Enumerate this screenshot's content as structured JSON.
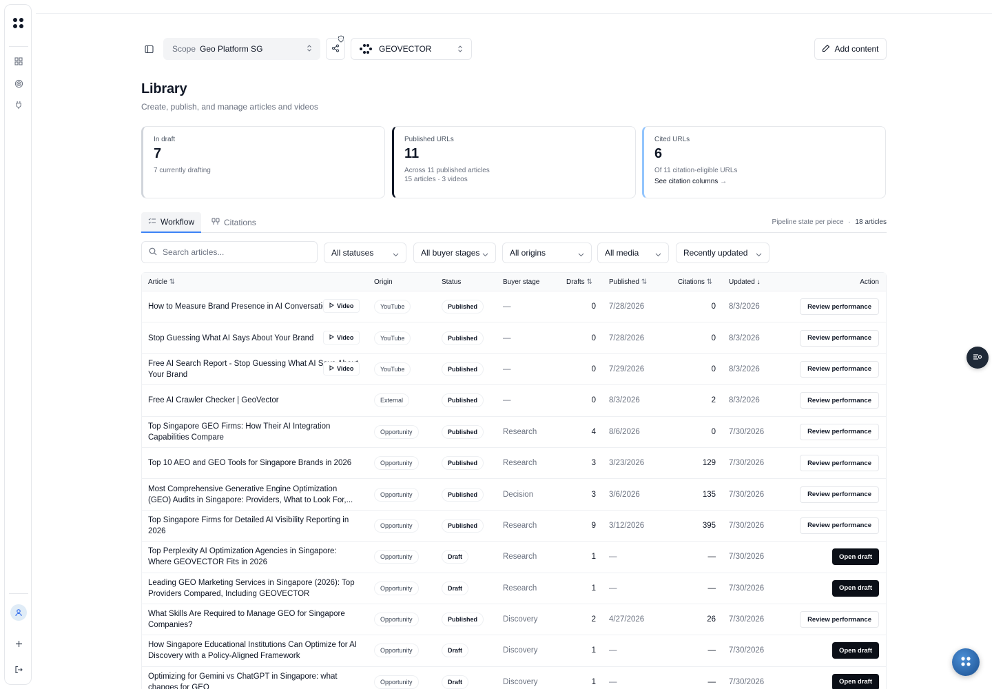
{
  "toolbar": {
    "scope_label": "Scope",
    "scope_value": "Geo Platform SG",
    "brand_name": "GEOVECTOR",
    "add_content_label": "Add content"
  },
  "page": {
    "title": "Library",
    "subtitle": "Create, publish, and manage articles and videos"
  },
  "stats": {
    "draft": {
      "label": "In draft",
      "value": "7",
      "desc": "7 currently drafting"
    },
    "published": {
      "label": "Published URLs",
      "value": "11",
      "desc1": "Across 11 published articles",
      "desc2": "15 articles · 3 videos"
    },
    "cited": {
      "label": "Cited URLs",
      "value": "6",
      "desc": "Of 11 citation-eligible URLs",
      "link": "See citation columns"
    }
  },
  "tabs": {
    "workflow": "Workflow",
    "citations": "Citations",
    "meta_label": "Pipeline state per piece",
    "meta_dot": "·",
    "meta_count": "18 articles"
  },
  "filters": {
    "search_placeholder": "Search articles...",
    "status": "All statuses",
    "buyer_stage": "All buyer stages",
    "origin": "All origins",
    "media": "All media",
    "sort": "Recently updated"
  },
  "table": {
    "headers": {
      "article": "Article",
      "origin": "Origin",
      "status": "Status",
      "buyer_stage": "Buyer stage",
      "drafts": "Drafts",
      "published": "Published",
      "citations": "Citations",
      "updated": "Updated",
      "action": "Action"
    },
    "video_label": "Video",
    "rows": [
      {
        "article": "How to Measure Brand Presence in AI Conversations",
        "video": true,
        "origin": "YouTube",
        "status": "Published",
        "stage": "—",
        "drafts": "0",
        "published": "7/28/2026",
        "citations": "0",
        "updated": "8/3/2026",
        "action": "Review performance"
      },
      {
        "article": "Stop Guessing What AI Says About Your Brand",
        "video": true,
        "origin": "YouTube",
        "status": "Published",
        "stage": "—",
        "drafts": "0",
        "published": "7/28/2026",
        "citations": "0",
        "updated": "8/3/2026",
        "action": "Review performance"
      },
      {
        "article": "Free AI Search Report - Stop Guessing What AI Says About Your Brand",
        "video": true,
        "origin": "YouTube",
        "status": "Published",
        "stage": "—",
        "drafts": "0",
        "published": "7/29/2026",
        "citations": "0",
        "updated": "8/3/2026",
        "action": "Review performance"
      },
      {
        "article": "Free AI Crawler Checker | GeoVector",
        "video": false,
        "origin": "External",
        "status": "Published",
        "stage": "—",
        "drafts": "0",
        "published": "8/3/2026",
        "citations": "2",
        "updated": "8/3/2026",
        "action": "Review performance"
      },
      {
        "article": "Top Singapore GEO Firms: How Their AI Integration Capabilities Compare",
        "video": false,
        "origin": "Opportunity",
        "status": "Published",
        "stage": "Research",
        "drafts": "4",
        "published": "8/6/2026",
        "citations": "0",
        "updated": "7/30/2026",
        "action": "Review performance"
      },
      {
        "article": "Top 10 AEO and GEO Tools for Singapore Brands in 2026",
        "video": false,
        "origin": "Opportunity",
        "status": "Published",
        "stage": "Research",
        "drafts": "3",
        "published": "3/23/2026",
        "citations": "129",
        "updated": "7/30/2026",
        "action": "Review performance"
      },
      {
        "article": "Most Comprehensive Generative Engine Optimization (GEO) Audits in Singapore: Providers, What to Look For,...",
        "video": false,
        "origin": "Opportunity",
        "status": "Published",
        "stage": "Decision",
        "drafts": "3",
        "published": "3/6/2026",
        "citations": "135",
        "updated": "7/30/2026",
        "action": "Review performance"
      },
      {
        "article": "Top Singapore Firms for Detailed AI Visibility Reporting in 2026",
        "video": false,
        "origin": "Opportunity",
        "status": "Published",
        "stage": "Research",
        "drafts": "9",
        "published": "3/12/2026",
        "citations": "395",
        "updated": "7/30/2026",
        "action": "Review performance"
      },
      {
        "article": "Top Perplexity AI Optimization Agencies in Singapore: Where GEOVECTOR Fits in 2026",
        "video": false,
        "origin": "Opportunity",
        "status": "Draft",
        "stage": "Research",
        "drafts": "1",
        "published": "—",
        "citations": "—",
        "updated": "7/30/2026",
        "action": "Open draft"
      },
      {
        "article": "Leading GEO Marketing Services in Singapore (2026): Top Providers Compared, Including GEOVECTOR",
        "video": false,
        "origin": "Opportunity",
        "status": "Draft",
        "stage": "Research",
        "drafts": "1",
        "published": "—",
        "citations": "—",
        "updated": "7/30/2026",
        "action": "Open draft"
      },
      {
        "article": "What Skills Are Required to Manage GEO for Singapore Companies?",
        "video": false,
        "origin": "Opportunity",
        "status": "Published",
        "stage": "Discovery",
        "drafts": "2",
        "published": "4/27/2026",
        "citations": "26",
        "updated": "7/30/2026",
        "action": "Review performance"
      },
      {
        "article": "How Singapore Educational Institutions Can Optimize for AI Discovery with a Policy-Aligned Framework",
        "video": false,
        "origin": "Opportunity",
        "status": "Draft",
        "stage": "Discovery",
        "drafts": "1",
        "published": "—",
        "citations": "—",
        "updated": "7/30/2026",
        "action": "Open draft"
      },
      {
        "article": "Optimizing for Gemini vs ChatGPT in Singapore: what changes for GEO",
        "video": false,
        "origin": "Opportunity",
        "status": "Draft",
        "stage": "Discovery",
        "drafts": "1",
        "published": "—",
        "citations": "—",
        "updated": "7/30/2026",
        "action": "Open draft"
      }
    ]
  }
}
